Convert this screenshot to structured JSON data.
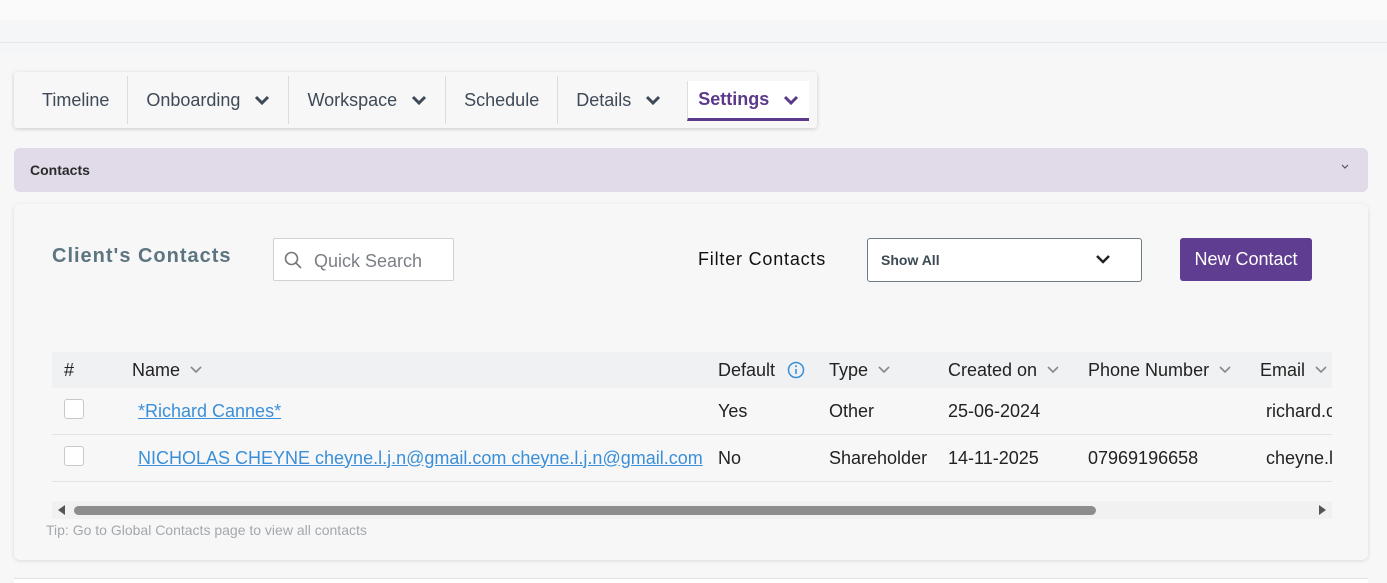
{
  "tabs": [
    {
      "label": "Timeline",
      "has_dropdown": false
    },
    {
      "label": "Onboarding",
      "has_dropdown": true
    },
    {
      "label": "Workspace",
      "has_dropdown": true
    },
    {
      "label": "Schedule",
      "has_dropdown": false
    },
    {
      "label": "Details",
      "has_dropdown": true
    },
    {
      "label": "Settings",
      "has_dropdown": true,
      "active": true
    }
  ],
  "section": {
    "title": "Contacts"
  },
  "contacts": {
    "title": "Client's Contacts",
    "search_placeholder": "Quick Search",
    "filter_label": "Filter Contacts",
    "filter_value": "Show All",
    "new_button": "New Contact",
    "columns": [
      "#",
      "Name",
      "Default",
      "Type",
      "Created on",
      "Phone Number",
      "Email"
    ],
    "rows": [
      {
        "name": "*Richard Cannes*",
        "default": "Yes",
        "type": "Other",
        "created_on": "25-06-2024",
        "phone": "",
        "email": "richard.c"
      },
      {
        "name": "NICHOLAS CHEYNE cheyne.l.j.n@gmail.com cheyne.l.j.n@gmail.com",
        "default": "No",
        "type": "Shareholder",
        "created_on": "14-11-2025",
        "phone": "07969196658",
        "email": "cheyne.l"
      }
    ],
    "tip": "Tip: Go to Global Contacts page to view all contacts"
  },
  "colors": {
    "accent": "#5f3d91",
    "link": "#3a8fd9",
    "section_bg": "#e1dbe9"
  },
  "icons": {
    "tab_chevron": "chevron-down-icon",
    "search": "search-icon",
    "info": "info-icon",
    "sort": "sort-chevron-icon"
  }
}
